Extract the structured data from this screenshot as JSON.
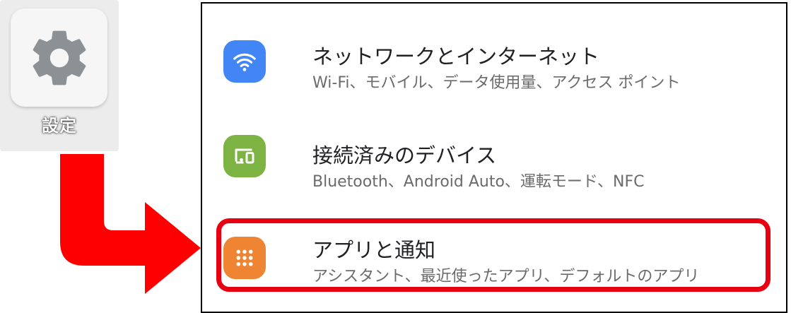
{
  "launcher": {
    "app_label": "設定",
    "icon": "gear-icon"
  },
  "settings_list": {
    "items": [
      {
        "title": "ネットワークとインターネット",
        "subtitle": "Wi-Fi、モバイル、データ使用量、アクセス ポイント",
        "icon": "wifi-icon",
        "icon_color": "#4285f4"
      },
      {
        "title": "接続済みのデバイス",
        "subtitle": "Bluetooth、Android Auto、運転モード、NFC",
        "icon": "connected-devices-icon",
        "icon_color": "#7cb342"
      },
      {
        "title": "アプリと通知",
        "subtitle": "アシスタント、最近使ったアプリ、デフォルトのアプリ",
        "icon": "apps-grid-icon",
        "icon_color": "#ef8433",
        "highlighted": true
      }
    ]
  },
  "annotation": {
    "arrow_color": "#ff0000",
    "highlight_color": "#e60012"
  }
}
